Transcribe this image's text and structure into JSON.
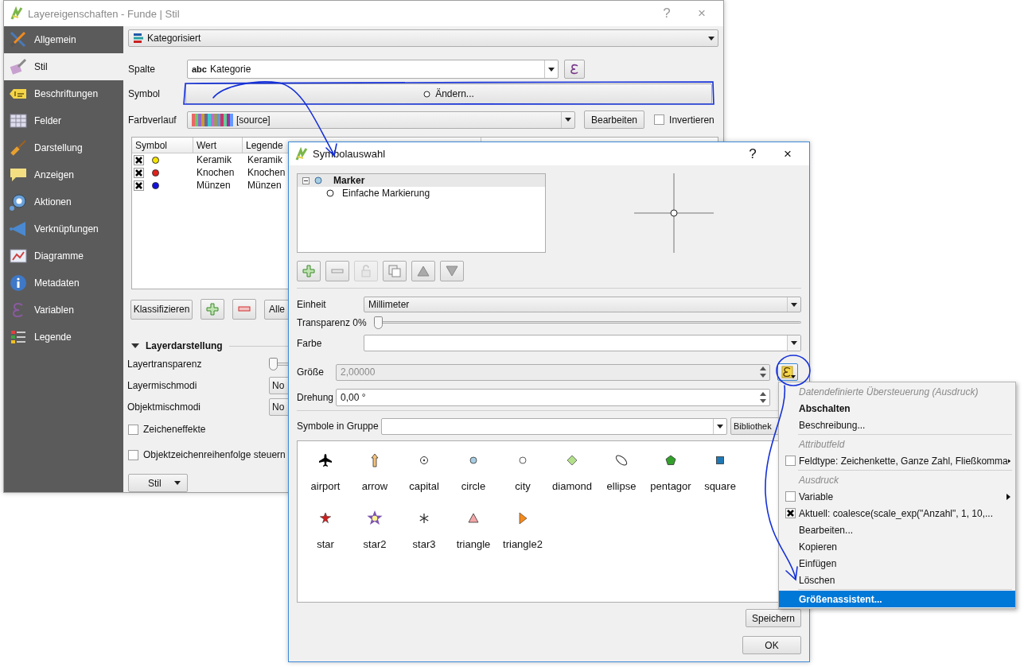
{
  "main_window": {
    "title": "Layereigenschaften - Funde | Stil",
    "help": "?",
    "close": "×",
    "sidebar": [
      {
        "label": "Allgemein",
        "selected": false
      },
      {
        "label": "Stil",
        "selected": true
      },
      {
        "label": "Beschriftungen",
        "selected": false
      },
      {
        "label": "Felder",
        "selected": false
      },
      {
        "label": "Darstellung",
        "selected": false
      },
      {
        "label": "Anzeigen",
        "selected": false
      },
      {
        "label": "Aktionen",
        "selected": false
      },
      {
        "label": "Verknüpfungen",
        "selected": false
      },
      {
        "label": "Diagramme",
        "selected": false
      },
      {
        "label": "Metadaten",
        "selected": false
      },
      {
        "label": "Variablen",
        "selected": false
      },
      {
        "label": "Legende",
        "selected": false
      }
    ],
    "renderer": "Kategorisiert",
    "column": {
      "label": "Spalte",
      "type_badge": "abc",
      "value": "Kategorie"
    },
    "symbol": {
      "label": "Symbol",
      "button": "Ändern..."
    },
    "color_ramp": {
      "label": "Farbverlauf",
      "value": "[source]",
      "edit_button": "Bearbeiten",
      "invert": {
        "label": "Invertieren",
        "checked": false
      }
    },
    "table": {
      "columns": [
        "Symbol",
        "Wert",
        "Legende"
      ],
      "rows": [
        {
          "checked": true,
          "color": "#f5e400",
          "value": "Keramik",
          "legend": "Keramik"
        },
        {
          "checked": true,
          "color": "#e3201b",
          "value": "Knochen",
          "legend": "Knochen"
        },
        {
          "checked": true,
          "color": "#1010e0",
          "value": "Münzen",
          "legend": "Münzen"
        }
      ]
    },
    "classify_button": "Klassifizieren",
    "all_button": "Alle",
    "layer_rendering": {
      "title": "Layerdarstellung",
      "expanded": true,
      "rows": [
        {
          "kind": "slider",
          "label": "Layertransparenz",
          "level": 0
        },
        {
          "kind": "combo",
          "label": "Layermischmodi",
          "value": "No"
        },
        {
          "kind": "combo",
          "label": "Objektmischmodi",
          "value": "No"
        }
      ],
      "checks": [
        {
          "label": "Zeicheneffekte",
          "checked": false
        },
        {
          "label": "Objektzeichenreihenfolge steuern",
          "checked": false
        }
      ]
    },
    "style_button": "Stil"
  },
  "dialog": {
    "title": "Symbolauswahl",
    "help": "?",
    "close": "×",
    "layers": [
      {
        "label": "Marker",
        "expanded": true,
        "selected": true,
        "children": [
          {
            "label": "Einfache Markierung",
            "selected": false
          }
        ]
      }
    ],
    "toolbar": [
      {
        "kind": "add",
        "disabled": false
      },
      {
        "kind": "remove",
        "disabled": false
      },
      {
        "kind": "lock",
        "disabled": true
      },
      {
        "kind": "duplicate",
        "disabled": false
      },
      {
        "kind": "up",
        "disabled": false
      },
      {
        "kind": "down",
        "disabled": false
      }
    ],
    "unit": {
      "label": "Einheit",
      "value": "Millimeter"
    },
    "transparency": {
      "label": "Transparenz 0%",
      "level": 0
    },
    "color": {
      "label": "Farbe"
    },
    "size": {
      "label": "Größe",
      "value": "2,00000",
      "disabled": true
    },
    "rotation": {
      "label": "Drehung",
      "value": "0,00 °",
      "disabled": false
    },
    "group": {
      "label": "Symbole in Gruppe",
      "library_button": "Bibliothek"
    },
    "symbols": [
      {
        "label": "airport"
      },
      {
        "label": "arrow"
      },
      {
        "label": "capital"
      },
      {
        "label": "circle"
      },
      {
        "label": "city"
      },
      {
        "label": "diamond"
      },
      {
        "label": "ellipse"
      },
      {
        "label": "pentagor"
      },
      {
        "label": "square"
      },
      {
        "label": "star"
      },
      {
        "label": "star2"
      },
      {
        "label": "star3"
      },
      {
        "label": "triangle"
      },
      {
        "label": "triangle2"
      }
    ],
    "save_button": "Speichern",
    "ok_button": "OK"
  },
  "menu": {
    "items": [
      {
        "kind": "header",
        "label": "Datendefinierte Übersteuerung (Ausdruck)"
      },
      {
        "kind": "action",
        "label": "Abschalten",
        "emphasized": true,
        "selected": false
      },
      {
        "kind": "action",
        "label": "Beschreibung...",
        "emphasized": false,
        "selected": false
      },
      {
        "kind": "separator"
      },
      {
        "kind": "header",
        "label": "Attributfeld"
      },
      {
        "kind": "check",
        "label": "Feldtype: Zeichenkette, Ganze Zahl, Fließkomma",
        "checked": false,
        "submenu": true,
        "selected": false
      },
      {
        "kind": "separator"
      },
      {
        "kind": "header",
        "label": "Ausdruck"
      },
      {
        "kind": "check",
        "label": "Variable",
        "checked": false,
        "submenu": true,
        "selected": false
      },
      {
        "kind": "check",
        "label": "Aktuell: coalesce(scale_exp(\"Anzahl\", 1, 10,...",
        "checked": true,
        "submenu": false,
        "selected": false
      },
      {
        "kind": "action",
        "label": "Bearbeiten...",
        "emphasized": false,
        "selected": false
      },
      {
        "kind": "action",
        "label": "Kopieren",
        "emphasized": false,
        "selected": false
      },
      {
        "kind": "action",
        "label": "Einfügen",
        "emphasized": false,
        "selected": false
      },
      {
        "kind": "action",
        "label": "Löschen",
        "emphasized": false,
        "selected": false
      },
      {
        "kind": "separator"
      },
      {
        "kind": "action",
        "label": "Größenassistent...",
        "emphasized": true,
        "selected": true
      }
    ]
  }
}
